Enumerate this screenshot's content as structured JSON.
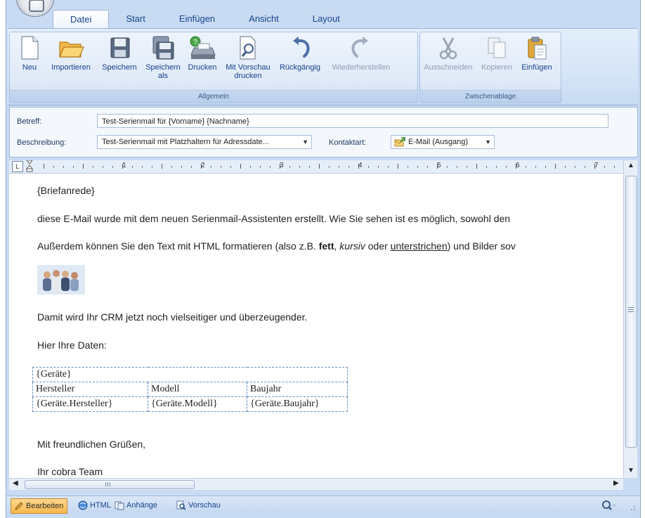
{
  "tabs": [
    "Datei",
    "Start",
    "Einfügen",
    "Ansicht",
    "Layout"
  ],
  "ribbon": {
    "group_allgemein": "Allgemein",
    "group_zwischenablage": "Zwischenablage",
    "neu": "Neu",
    "importieren": "Importieren",
    "speichern": "Speichern",
    "speichern_als_1": "Speichern",
    "speichern_als_2": "als",
    "drucken": "Drucken",
    "vorschau_1": "Mit Vorschau",
    "vorschau_2": "drucken",
    "rueckgaengig": "Rückgängig",
    "wiederherstellen": "Wiederherstellen",
    "ausschneiden": "Ausschneiden",
    "kopieren": "Kopieren",
    "einfuegen": "Einfügen"
  },
  "form": {
    "betreff_label": "Betreff:",
    "betreff_value": "Test-Serienmail für {Vorname} {Nachname}",
    "beschreibung_label": "Beschreibung:",
    "beschreibung_value": "Test-Serienmail mit Platzhaltern für Adressdate...",
    "kontaktart_label": "Kontaktart:",
    "kontaktart_value": "E-Mail (Ausgang)"
  },
  "ruler": {
    "numbers": [
      "1",
      "2",
      "3",
      "4",
      "5",
      "6",
      "7"
    ]
  },
  "editor": {
    "line1": "{Briefanrede}",
    "line2": "diese E-Mail wurde mit dem neuen Serienmail-Assistenten erstellt. Wie Sie sehen ist es möglich, sowohl den",
    "line3_a": "Außerdem  können Sie den Text mit HTML formatieren (also z.B. ",
    "line3_bold": "fett",
    "line3_b": ", ",
    "line3_italic": "kursiv",
    "line3_c": " oder ",
    "line3_underline": "unterstrichen",
    "line3_d": ") und Bilder sov",
    "line4": "Damit wird Ihr CRM jetzt noch vielseitiger und überzeugender.",
    "line5": "Hier Ihre Daten:",
    "table": {
      "title": "{Geräte}",
      "headers": [
        "Hersteller",
        "Modell",
        "Baujahr"
      ],
      "row": [
        "{Geräte.Hersteller}",
        "{Geräte.Modell}",
        "{Geräte.Baujahr}"
      ]
    },
    "line6": "Mit freundlichen Grüßen,",
    "line7": "Ihr cobra Team"
  },
  "statusbar": {
    "bearbeiten": "Bearbeiten",
    "html": "HTML",
    "anhaenge": "Anhänge",
    "vorschau": "Vorschau"
  }
}
